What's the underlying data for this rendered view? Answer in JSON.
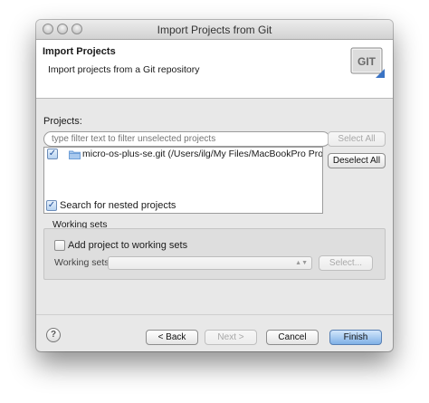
{
  "window": {
    "title": "Import Projects from Git"
  },
  "header": {
    "title": "Import Projects",
    "description": "Import projects from a Git repository",
    "logo_text": "GIT"
  },
  "projects": {
    "label": "Projects:",
    "filter_placeholder": "type filter text to filter unselected projects",
    "select_all_label": "Select All",
    "deselect_all_label": "Deselect All",
    "items": [
      {
        "label": "micro-os-plus-se.git (/Users/ilg/My Files/MacBookPro Projects/uOS/m",
        "checked": true
      }
    ]
  },
  "nested": {
    "label": "Search for nested projects",
    "checked": true
  },
  "working_sets": {
    "group_label": "Working sets",
    "add_label": "Add project to working sets",
    "add_checked": false,
    "sets_label": "Working sets:",
    "select_value": "",
    "select_button_label": "Select..."
  },
  "footer": {
    "help_symbol": "?",
    "back_label": "< Back",
    "next_label": "Next >",
    "cancel_label": "Cancel",
    "finish_label": "Finish"
  },
  "colors": {
    "default_button": "#7fb0e6",
    "folder": "#6f9fd8"
  },
  "icons": {
    "folder": "project-folder-icon",
    "help": "help-icon"
  }
}
